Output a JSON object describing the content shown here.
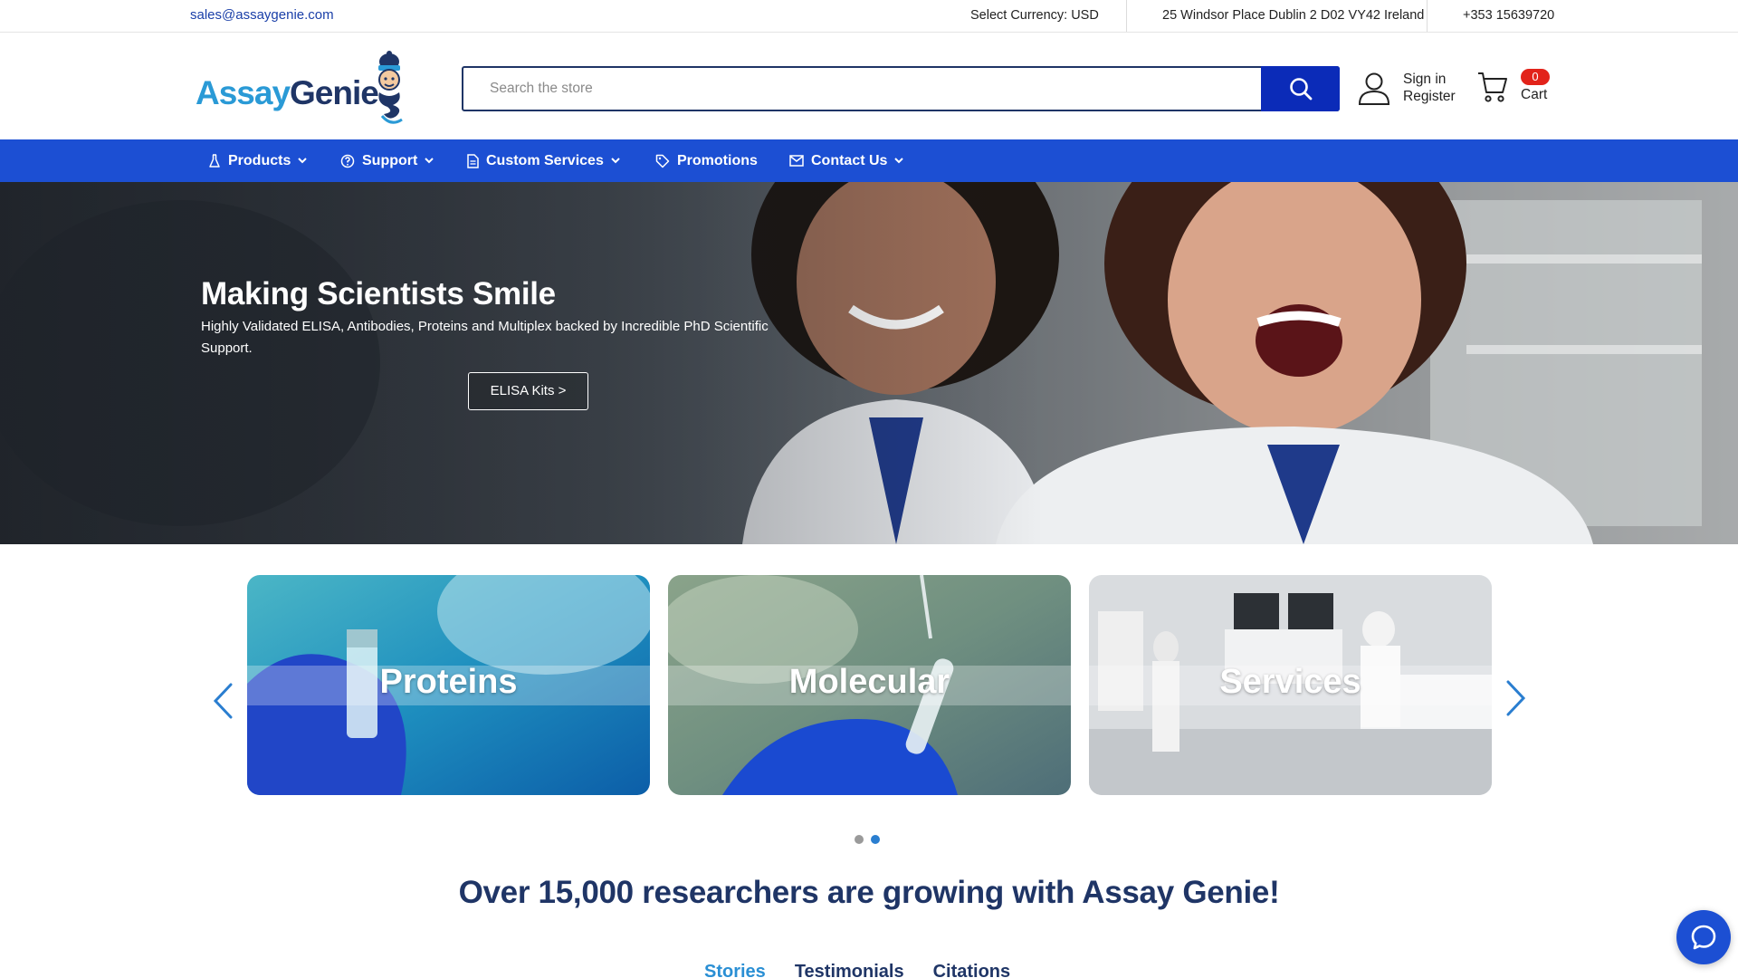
{
  "topbar": {
    "email": "sales@assaygenie.com",
    "currency": "Select Currency: USD",
    "address": "25 Windsor Place Dublin 2 D02 VY42 Ireland",
    "phone": "+353 15639720"
  },
  "header": {
    "logo_part1": "Assay",
    "logo_part2": "Genie",
    "search_placeholder": "Search the store",
    "sign_in": "Sign in",
    "register": "Register",
    "cart_count": "0",
    "cart_label": "Cart"
  },
  "nav": {
    "items": [
      {
        "label": "Products",
        "icon": "flask-icon",
        "has_menu": true
      },
      {
        "label": "Support",
        "icon": "help-circle-icon",
        "has_menu": true
      },
      {
        "label": "Custom Services",
        "icon": "document-icon",
        "has_menu": true
      },
      {
        "label": "Promotions",
        "icon": "tag-icon",
        "has_menu": false
      },
      {
        "label": "Contact Us",
        "icon": "mail-icon",
        "has_menu": true
      }
    ]
  },
  "hero": {
    "title": "Making Scientists Smile",
    "subtitle": "Highly Validated ELISA, Antibodies, Proteins and Multiplex backed by Incredible PhD Scientific Support.",
    "cta": "ELISA Kits >"
  },
  "categories": [
    {
      "title": "Proteins"
    },
    {
      "title": "Molecular"
    },
    {
      "title": "Services"
    }
  ],
  "carousel": {
    "dots": 2,
    "active_dot": 1
  },
  "section": {
    "heading": "Over 15,000 researchers are growing with Assay Genie!",
    "tabs": [
      {
        "label": "Stories",
        "active": true
      },
      {
        "label": "Testimonials",
        "active": false
      },
      {
        "label": "Citations",
        "active": false
      }
    ]
  },
  "colors": {
    "brand_blue": "#1c4fd3",
    "navy": "#1f3566",
    "light_blue": "#2a9ad6",
    "search_button": "#0b2bb8",
    "badge_red": "#e2231a"
  }
}
